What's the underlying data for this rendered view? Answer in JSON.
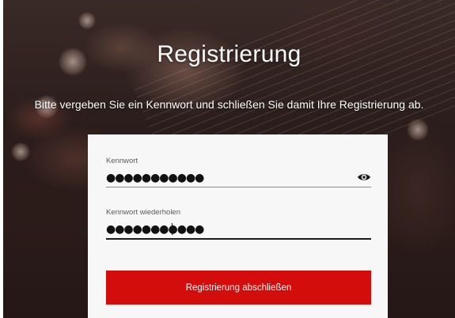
{
  "page": {
    "title": "Registrierung",
    "subtitle": "Bitte vergeben Sie ein Kennwort und schließen Sie damit Ihre Registrierung ab."
  },
  "form": {
    "password": {
      "label": "Kennwort",
      "value": "●●●●●●●●●●●",
      "toggle_icon": "eye-icon"
    },
    "password_repeat": {
      "label": "Kennwort wiederholen",
      "value": "●●●●●●●●●●●"
    },
    "submit_label": "Registrierung abschließen"
  },
  "colors": {
    "accent": "#d30c0c",
    "card_background": "#f7f7f7",
    "text_on_dark": "#ffffff"
  }
}
